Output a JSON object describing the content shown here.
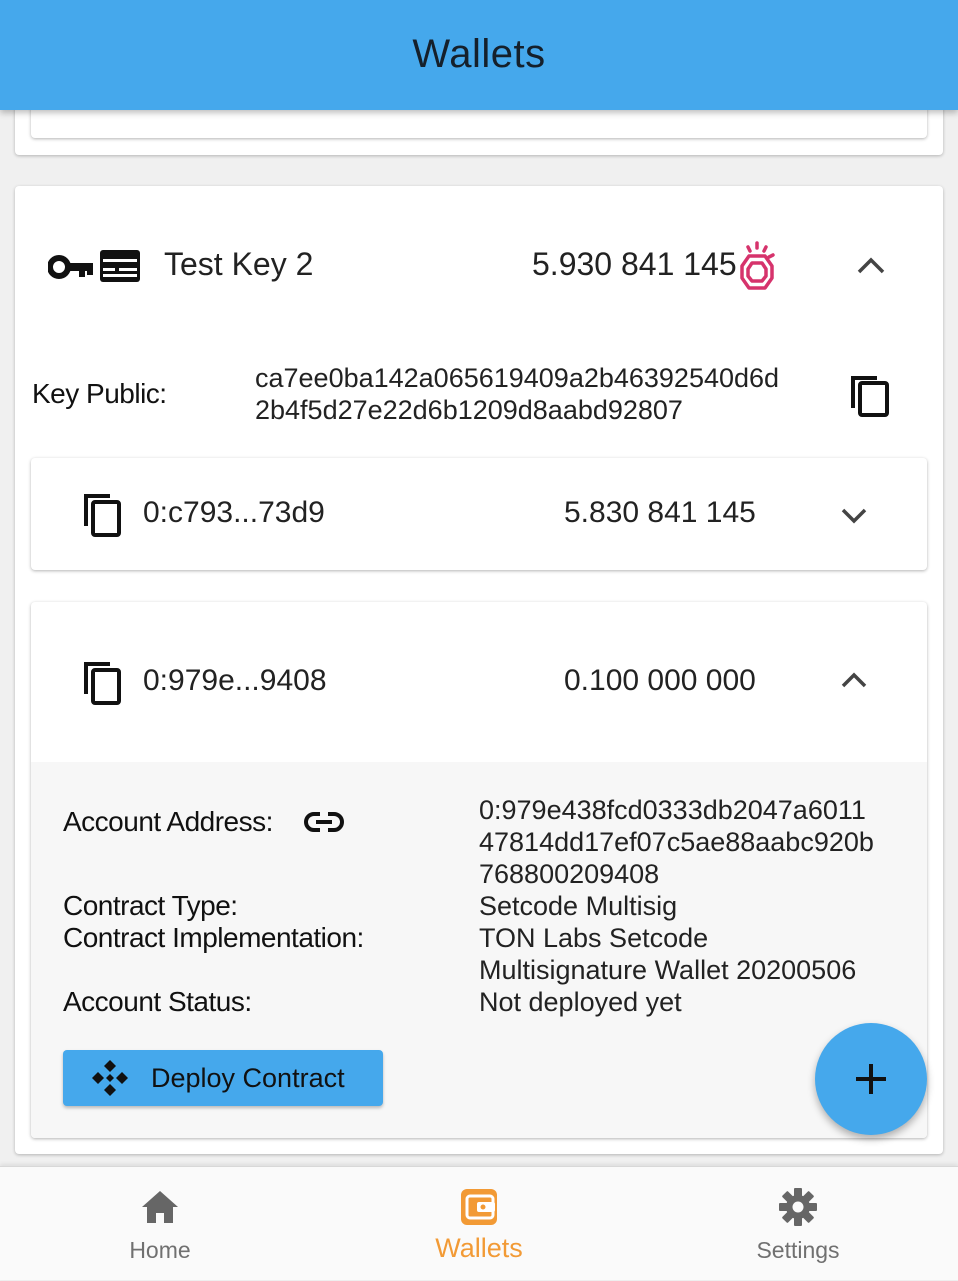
{
  "appbar": {
    "title": "Wallets"
  },
  "key_card": {
    "name": "Test Key 2",
    "balance": "5.930 841 145",
    "public_key_label": "Key Public:",
    "public_key_line1": "ca7ee0ba142a065619409a2b46392540d6d",
    "public_key_line2": "2b4f5d27e22d6b1209d8aabd92807",
    "accounts": [
      {
        "address": "0:c793...73d9",
        "balance": "5.830 841 145",
        "expanded": false
      },
      {
        "address": "0:979e...9408",
        "balance": "0.100 000 000",
        "expanded": true
      }
    ]
  },
  "details": {
    "account_address_label": "Account Address:",
    "account_address_line1": "0:979e438fcd0333db2047a6011",
    "account_address_line2": "47814dd17ef07c5ae88aabc920b",
    "account_address_line3": "768800209408",
    "contract_type_label": "Contract Type:",
    "contract_type_value": "Setcode Multisig",
    "contract_impl_label": "Contract Implementation:",
    "contract_impl_line1": "TON Labs Setcode",
    "contract_impl_line2": "Multisignature Wallet 20200506",
    "account_status_label": "Account Status:",
    "account_status_value": "Not deployed yet",
    "deploy_label": "Deploy Contract"
  },
  "bottom_nav": {
    "items": [
      {
        "label": "Home",
        "icon": "home-icon"
      },
      {
        "label": "Wallets",
        "icon": "wallet-icon",
        "active": true
      },
      {
        "label": "Settings",
        "icon": "gear-icon"
      }
    ]
  },
  "colors": {
    "primary": "#45a8ec",
    "active_nav": "#f29a35",
    "gem": "#d6336c"
  }
}
